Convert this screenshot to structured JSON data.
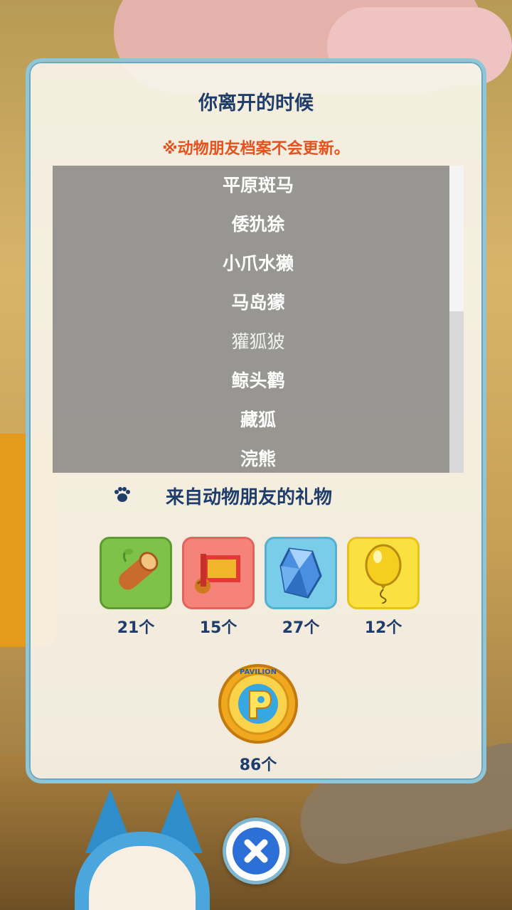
{
  "dialog": {
    "title": "你离开的时候",
    "notice": "※动物朋友档案不会更新。"
  },
  "animals": [
    {
      "name": "平原斑马",
      "dim": false
    },
    {
      "name": "倭犰狳",
      "dim": false
    },
    {
      "name": "小爪水獭",
      "dim": false
    },
    {
      "name": "马岛獴",
      "dim": false
    },
    {
      "name": "獾狐狓",
      "dim": true
    },
    {
      "name": "鲸头鹳",
      "dim": false
    },
    {
      "name": "藏狐",
      "dim": false
    },
    {
      "name": "浣熊",
      "dim": false
    }
  ],
  "gifts": {
    "title": "来自动物朋友的礼物",
    "items": [
      {
        "icon": "wood-log-icon",
        "count": "21个",
        "bg": "#7fc24a",
        "border": "#5d9a30"
      },
      {
        "icon": "red-scroll-icon",
        "count": "15个",
        "bg": "#f5837a",
        "border": "#e0665d"
      },
      {
        "icon": "crystal-icon",
        "count": "27个",
        "bg": "#79cde8",
        "border": "#56b1cf"
      },
      {
        "icon": "balloon-icon",
        "count": "12个",
        "bg": "#fbe13f",
        "border": "#e7c21f"
      }
    ],
    "coin": {
      "icon": "pavilion-coin-icon",
      "count": "86个",
      "coin_text": "PAVILION"
    }
  },
  "close": {
    "icon": "close-icon"
  }
}
